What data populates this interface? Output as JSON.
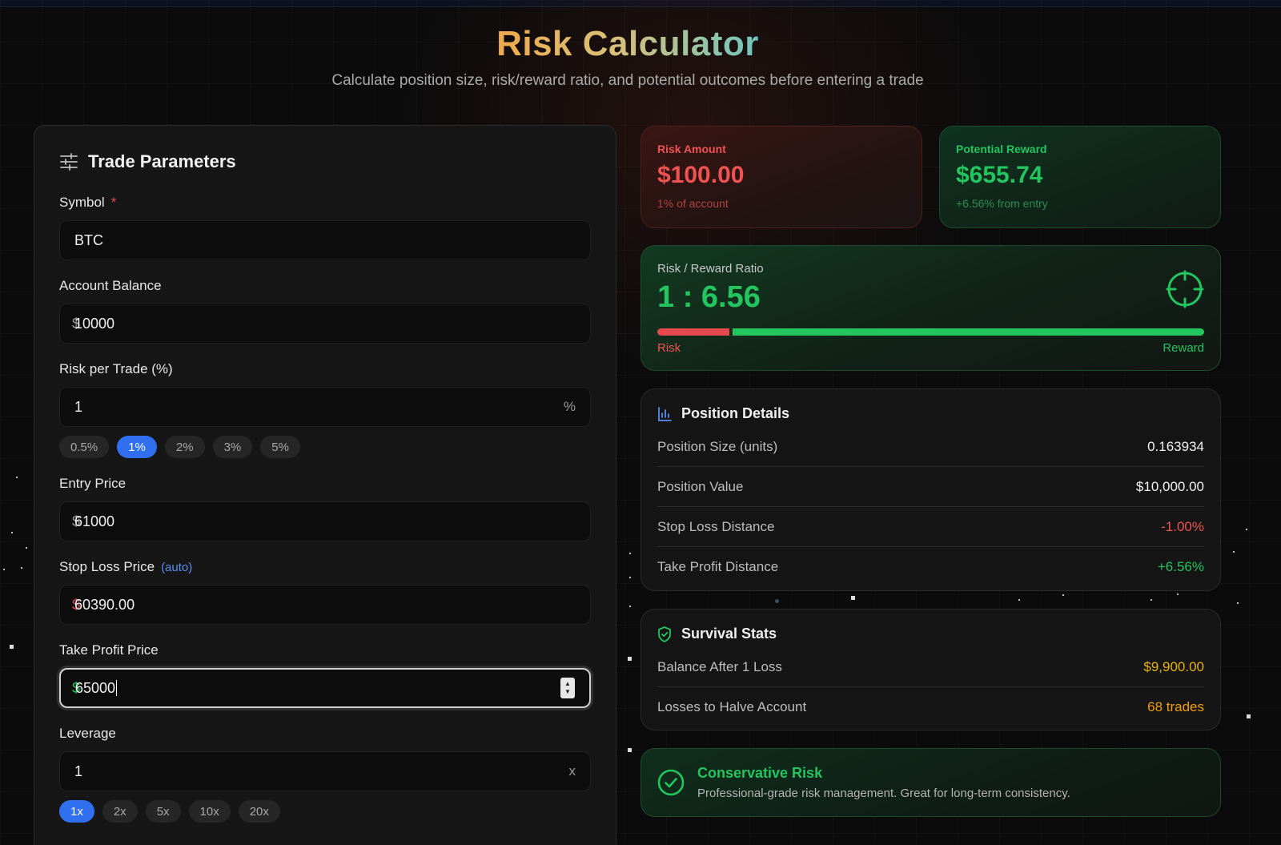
{
  "header": {
    "title": "Risk Calculator",
    "subtitle": "Calculate position size, risk/reward ratio, and potential outcomes before entering a trade"
  },
  "form": {
    "title": "Trade Parameters",
    "symbol": {
      "label": "Symbol",
      "required_mark": "*",
      "value": "BTC"
    },
    "balance": {
      "label": "Account Balance",
      "prefix": "$",
      "value": "10000"
    },
    "risk": {
      "label": "Risk per Trade (%)",
      "value": "1",
      "suffix": "%",
      "presets": [
        "0.5%",
        "1%",
        "2%",
        "3%",
        "5%"
      ],
      "selected": "1%"
    },
    "entry": {
      "label": "Entry Price",
      "prefix": "$",
      "value": "61000"
    },
    "stop_loss": {
      "label": "Stop Loss Price",
      "tag": "(auto)",
      "prefix": "$",
      "value": "60390.00"
    },
    "take_profit": {
      "label": "Take Profit Price",
      "prefix": "$",
      "value": "65000"
    },
    "leverage": {
      "label": "Leverage",
      "value": "1",
      "suffix": "x",
      "presets": [
        "1x",
        "2x",
        "5x",
        "10x",
        "20x"
      ],
      "selected": "1x"
    }
  },
  "risk_card": {
    "label": "Risk Amount",
    "value": "$100.00",
    "sub": "1% of account"
  },
  "reward_card": {
    "label": "Potential Reward",
    "value": "$655.74",
    "sub": "+6.56% from entry"
  },
  "rr": {
    "label": "Risk / Reward Ratio",
    "value": "1 : 6.56",
    "risk_label": "Risk",
    "reward_label": "Reward",
    "risk_fraction": 0.132
  },
  "position": {
    "title": "Position Details",
    "rows": [
      {
        "label": "Position Size (units)",
        "value": "0.163934",
        "color": "#f2f2f2"
      },
      {
        "label": "Position Value",
        "value": "$10,000.00",
        "color": "#f2f2f2"
      },
      {
        "label": "Stop Loss Distance",
        "value": "-1.00%",
        "color": "#f05252"
      },
      {
        "label": "Take Profit Distance",
        "value": "+6.56%",
        "color": "#22c55e"
      }
    ]
  },
  "survival": {
    "title": "Survival Stats",
    "rows": [
      {
        "label": "Balance After 1 Loss",
        "value": "$9,900.00",
        "color": "#eab308"
      },
      {
        "label": "Losses to Halve Account",
        "value": "68 trades",
        "color": "#f59e0b"
      }
    ]
  },
  "assessment": {
    "title": "Conservative Risk",
    "text": "Professional-grade risk management. Great for long-term consistency."
  },
  "colors": {
    "accent": "#2f6ff0",
    "profit": "#22c55e",
    "loss": "#e5484d",
    "warning": "#eab308"
  }
}
